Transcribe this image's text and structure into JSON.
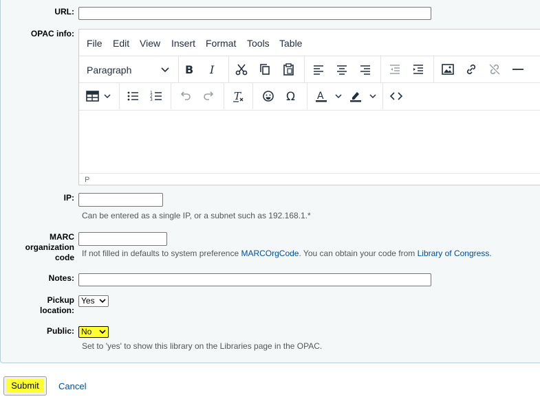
{
  "form": {
    "url_label": "URL:",
    "url_value": "",
    "opac_label": "OPAC info:",
    "ip_label": "IP:",
    "ip_value": "",
    "ip_hint": "Can be entered as a single IP, or a subnet such as 192.168.1.*",
    "marc_label_line1": "MARC",
    "marc_label_line2": "organization",
    "marc_label_line3": "code",
    "marc_value": "",
    "marc_hint_prefix": "If not filled in defaults to system preference ",
    "marc_hint_link1": "MARCOrgCode",
    "marc_hint_mid": ". You can obtain your code from ",
    "marc_hint_link2": "Library of Congress",
    "marc_hint_suffix": ".",
    "notes_label": "Notes:",
    "notes_value": "",
    "pickup_label_line1": "Pickup",
    "pickup_label_line2": "location:",
    "pickup_value": "Yes",
    "public_label": "Public:",
    "public_value": "No",
    "public_hint": "Set to 'yes' to show this library on the Libraries page in the OPAC."
  },
  "editor": {
    "menus": [
      "File",
      "Edit",
      "View",
      "Insert",
      "Format",
      "Tools",
      "Table"
    ],
    "block_format": "Paragraph",
    "status_path": "P",
    "toolbar_row1_icons": [
      "bold-icon",
      "italic-icon",
      "cut-icon",
      "copy-icon",
      "paste-icon",
      "align-left-icon",
      "align-center-icon",
      "align-right-icon",
      "outdent-icon",
      "indent-icon",
      "image-icon",
      "link-icon",
      "unlink-icon",
      "horizontal-rule-icon"
    ],
    "toolbar_row2_icons": [
      "table-icon",
      "bullet-list-icon",
      "numbered-list-icon",
      "undo-icon",
      "redo-icon",
      "clear-formatting-icon",
      "emoticons-icon",
      "special-character-icon",
      "text-color-icon",
      "highlight-color-icon",
      "source-code-icon"
    ]
  },
  "actions": {
    "submit_label": "Submit",
    "cancel_label": "Cancel"
  },
  "colors": {
    "highlight": "#ffff33",
    "link": "#004d99",
    "panel_bg": "#f4f8f9"
  }
}
